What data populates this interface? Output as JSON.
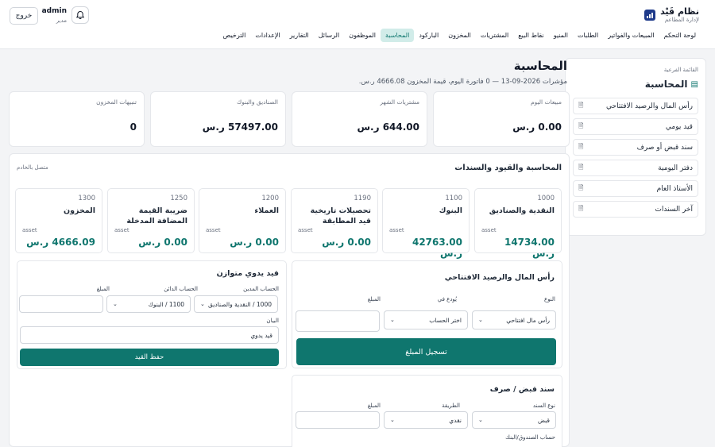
{
  "brand": {
    "title": "نظام قَيْد",
    "subtitle": "لإدارة المطاعم",
    "logo_icon": "chart-logo-icon"
  },
  "user": {
    "name": "admin",
    "role": "مدير",
    "logout_label": "خروج"
  },
  "nav": [
    "لوحة التحكم",
    "المبيعات والفواتير",
    "الطلبات",
    "المنيو",
    "نقاط البيع",
    "المشتريات",
    "المخزون",
    "الباركود",
    "المحاسبة",
    "الموظفون",
    "الرسائل",
    "التقارير",
    "الإعدادات",
    "الترخيص"
  ],
  "nav_active": "المحاسبة",
  "sidebar": {
    "label": "القائمة الفرعية",
    "title": "المحاسبة",
    "items": [
      "رأس المال والرصيد الافتتاحي",
      "قيد يومي",
      "سند قبض أو صرف",
      "دفتر اليومية",
      "الأستاذ العام",
      "آخر السندات"
    ]
  },
  "page": {
    "title": "المحاسبة",
    "subtitle": "مؤشرات 2026-09-13 — 0 فاتورة اليوم، قيمة المخزون 4666.08 ر.س."
  },
  "stats": [
    {
      "label": "مبيعات اليوم",
      "value": "0.00 ر.س"
    },
    {
      "label": "مشتريات الشهر",
      "value": "644.00 ر.س"
    },
    {
      "label": "الصناديق والبنوك",
      "value": "57497.00 ر.س"
    },
    {
      "label": "تنبيهات المخزون",
      "value": "0"
    }
  ],
  "section": {
    "title": "المحاسبة والقيود والسندات",
    "status": "متصل بالخادم"
  },
  "accounts": [
    {
      "code": "1000",
      "name": "النقدية والصناديق",
      "type": "asset",
      "balance": "14734.00 ر.س"
    },
    {
      "code": "1100",
      "name": "البنوك",
      "type": "asset",
      "balance": "42763.00 ر.س"
    },
    {
      "code": "1190",
      "name": "تحصيلات تاريخية قيد المطابقة",
      "type": "asset",
      "balance": "0.00 ر.س"
    },
    {
      "code": "1200",
      "name": "العملاء",
      "type": "asset",
      "balance": "0.00 ر.س"
    },
    {
      "code": "1250",
      "name": "ضريبة القيمة المضافة المدخلة",
      "type": "asset",
      "balance": "0.00 ر.س"
    },
    {
      "code": "1300",
      "name": "المخزون",
      "type": "asset",
      "balance": "4666.09 ر.س"
    }
  ],
  "opening": {
    "title": "رأس المال والرصيد الافتتاحي",
    "type_label": "النوع",
    "type_value": "رأس مال افتتاحي",
    "deposit_label": "يُودع في",
    "deposit_value": "اختر الحساب",
    "amount_label": "المبلغ",
    "amount_value": "",
    "submit_label": "تسجيل المبلغ"
  },
  "manual": {
    "title": "قيد يدوي متوازن",
    "debit_label": "الحساب المدين",
    "debit_value": "1000 / النقدية والصناديق",
    "credit_label": "الحساب الدائن",
    "credit_value": "1100 / البنوك",
    "amount_label": "المبلغ",
    "amount_value": "",
    "memo_label": "البيان",
    "memo_value": "قيد يدوي",
    "submit_label": "حفظ القيد"
  },
  "voucher": {
    "title": "سند قبض / صرف",
    "type_label": "نوع السند",
    "type_value": "قبض",
    "method_label": "الطريقة",
    "method_value": "نقدي",
    "amount_label": "المبلغ",
    "amount_value": "",
    "account_label": "حساب الصندوق/البنك"
  }
}
